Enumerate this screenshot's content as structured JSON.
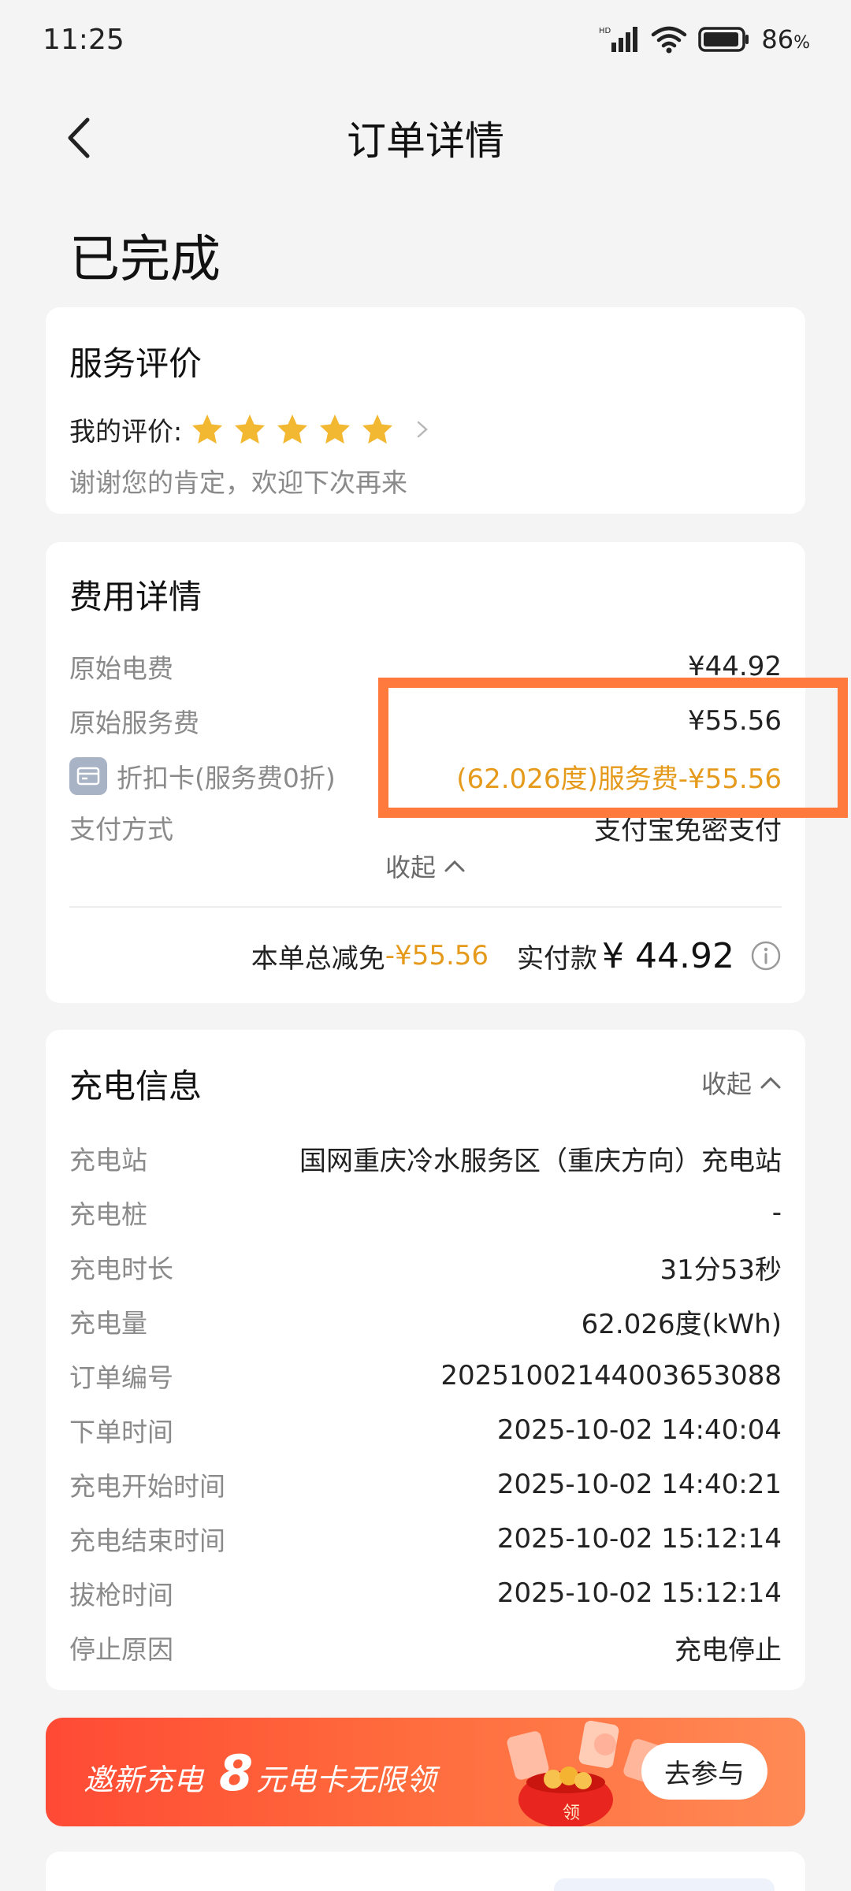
{
  "status_bar": {
    "time": "11:25",
    "network_badge": "HD",
    "battery": "86",
    "battery_unit": "%"
  },
  "nav": {
    "title": "订单详情"
  },
  "order_status": "已完成",
  "rating": {
    "title": "服务评价",
    "label": "我的评价:",
    "stars": 5,
    "stars_max": 5,
    "star_color": "#f2b832",
    "thanks": "谢谢您的肯定，欢迎下次再来"
  },
  "fees": {
    "title": "费用详情",
    "rows": [
      {
        "label": "原始电费",
        "value": "¥44.92"
      },
      {
        "label": "原始服务费",
        "value": "¥55.56"
      },
      {
        "label": "折扣卡(服务费0折)",
        "value": "(62.026度)服务费-¥55.56"
      },
      {
        "label": "支付方式",
        "value": "支付宝免密支付"
      }
    ],
    "collapse": "收起",
    "total_label": "本单总减免",
    "total_discount": "-¥55.56",
    "paid_label": "实付款",
    "paid_amount": "¥ 44.92",
    "accent_color": "#e59a1b"
  },
  "charging": {
    "title": "充电信息",
    "collapse": "收起",
    "rows": [
      {
        "label": "充电站",
        "value": "国网重庆冷水服务区（重庆方向）充电站"
      },
      {
        "label": "充电桩",
        "value": "-"
      },
      {
        "label": "充电时长",
        "value": "31分53秒"
      },
      {
        "label": "充电量",
        "value": "62.026度(kWh)"
      },
      {
        "label": "订单编号",
        "value": "20251002144003653088"
      },
      {
        "label": "下单时间",
        "value": "2025-10-02 14:40:04"
      },
      {
        "label": "充电开始时间",
        "value": "2025-10-02 14:40:21"
      },
      {
        "label": "充电结束时间",
        "value": "2025-10-02 15:12:14"
      },
      {
        "label": "拔枪时间",
        "value": "2025-10-02 15:12:14"
      },
      {
        "label": "停止原因",
        "value": "充电停止"
      }
    ]
  },
  "banner": {
    "prefix": "邀新充电",
    "number": "8",
    "suffix": "元电卡无限领",
    "button": "去参与",
    "gift_text": "领"
  },
  "highlight_color": "#ff7a3c"
}
